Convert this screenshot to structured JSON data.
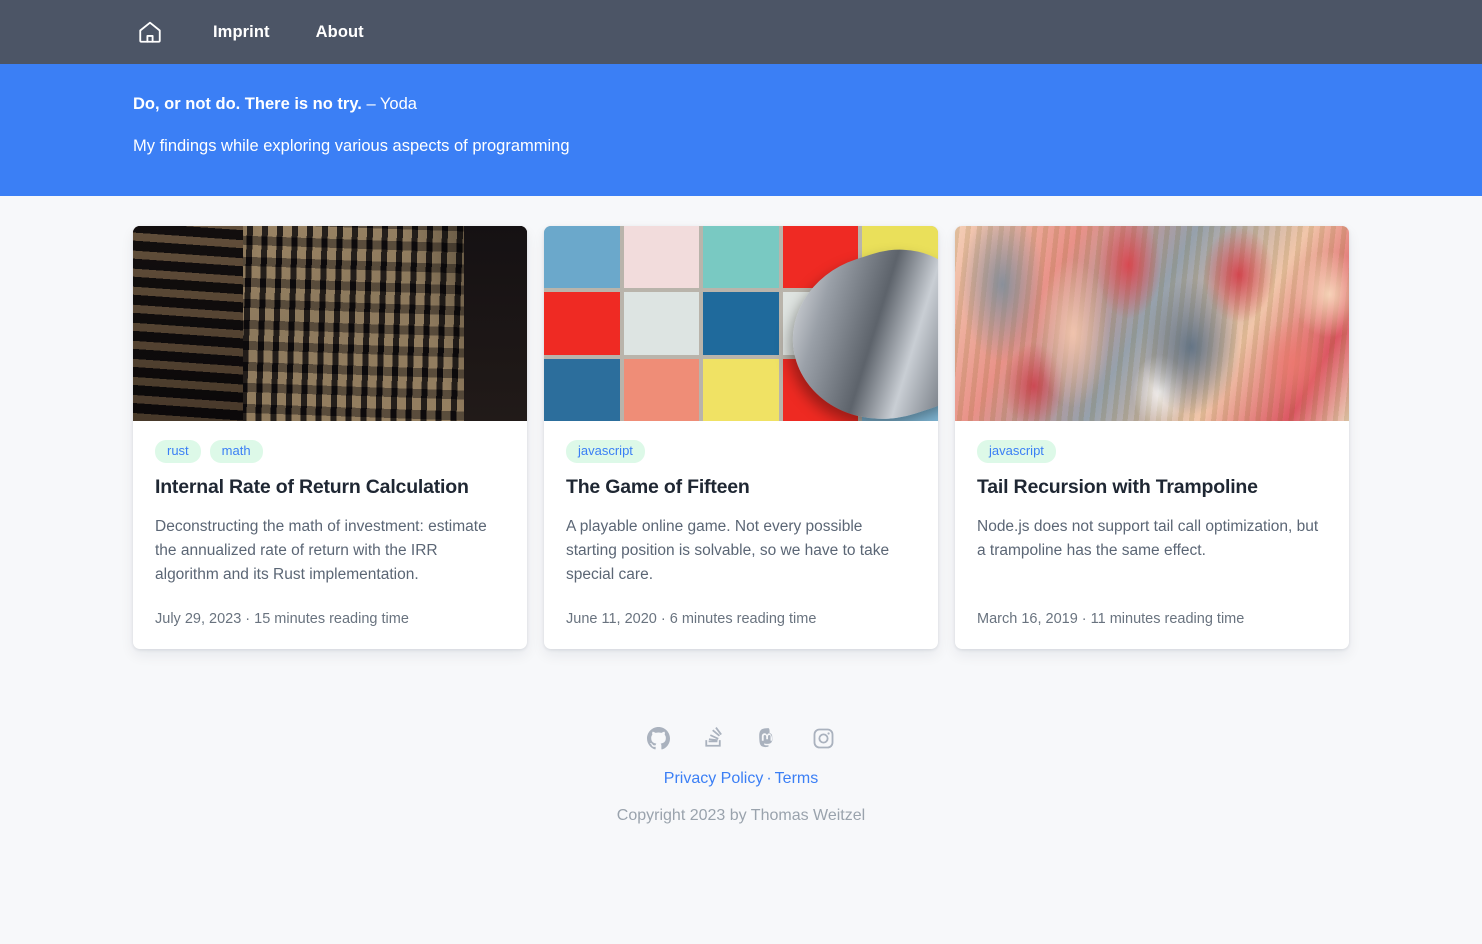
{
  "navbar": {
    "home_icon": "home-icon",
    "links": [
      {
        "label": "Imprint"
      },
      {
        "label": "About"
      }
    ]
  },
  "hero": {
    "quote": "Do, or not do. There is no try.",
    "author": "– Yoda",
    "subtitle": "My findings while exploring various aspects of programming",
    "background_color": "#3b7ff5"
  },
  "cards": [
    {
      "image_alt": "night-office-building-photo",
      "tags": [
        "rust",
        "math"
      ],
      "title": "Internal Rate of Return Calculation",
      "description": "Deconstructing the math of investment: estimate the annualized rate of return with the IRR algorithm and its Rust implementation.",
      "meta": "July 29, 2023 · 15 minutes reading time",
      "date": "July 29, 2023",
      "reading_time": "15 minutes reading time"
    },
    {
      "image_alt": "colored-tile-grid-photo",
      "tags": [
        "javascript"
      ],
      "title": "The Game of Fifteen",
      "description": "A playable online game. Not every possible starting position is solvable, so we have to take special care.",
      "meta": "June 11, 2020 · 6 minutes reading time",
      "date": "June 11, 2020",
      "reading_time": "6 minutes reading time"
    },
    {
      "image_alt": "abstract-painting-photo",
      "tags": [
        "javascript"
      ],
      "title": "Tail Recursion with Trampoline",
      "description": "Node.js does not support tail call optimization, but a trampoline has the same effect.",
      "meta": "March 16, 2019 · 11 minutes reading time",
      "date": "March 16, 2019",
      "reading_time": "11 minutes reading time"
    }
  ],
  "tile_colors": [
    "#6ba8cb",
    "#f2dcdc",
    "#79c9c2",
    "#ef2a23",
    "#eae05a",
    "#ef2a23",
    "#dde4e2",
    "#1f6a9c",
    "#dfe4e1",
    "#e8e3a0",
    "#2c6e9c",
    "#ef8d77",
    "#f0e264",
    "#ee2a22",
    "#7fb6d4"
  ],
  "footer": {
    "social": [
      {
        "name": "github-icon",
        "label": "GitHub"
      },
      {
        "name": "stackoverflow-icon",
        "label": "Stack Overflow"
      },
      {
        "name": "mastodon-icon",
        "label": "Mastodon"
      },
      {
        "name": "instagram-icon",
        "label": "Instagram"
      }
    ],
    "privacy_label": "Privacy Policy",
    "separator": "·",
    "terms_label": "Terms",
    "copyright": "Copyright 2023 by Thomas Weitzel"
  },
  "colors": {
    "navbar": "#4c5566",
    "hero": "#3b7ff5",
    "accent": "#3b7ff5",
    "tag_background": "#ddf9e8",
    "page_background": "#f7f8fa"
  }
}
